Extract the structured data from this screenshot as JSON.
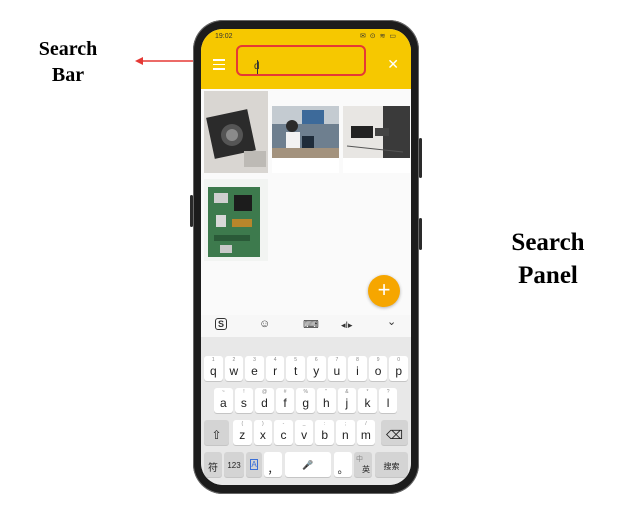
{
  "annotations": {
    "search_bar_line1": "Search",
    "search_bar_line2": "Bar",
    "search_panel_line1": "Search",
    "search_panel_line2": "Panel"
  },
  "status_bar": {
    "time": "19:02",
    "icons": "✉ ⊙ ≋ ▭"
  },
  "search": {
    "value": "d",
    "menu_icon": "menu-icon",
    "close_label": "✕"
  },
  "fab": {
    "label": "+"
  },
  "keyboard_toolbar": {
    "logo": "S",
    "emoji": "☺",
    "keyboard": "⌨",
    "cursor": "◂I▸",
    "collapse": "⌄"
  },
  "keyboard": {
    "row1": [
      {
        "hint": "1",
        "key": "q"
      },
      {
        "hint": "2",
        "key": "w"
      },
      {
        "hint": "3",
        "key": "e"
      },
      {
        "hint": "4",
        "key": "r"
      },
      {
        "hint": "5",
        "key": "t"
      },
      {
        "hint": "6",
        "key": "y"
      },
      {
        "hint": "7",
        "key": "u"
      },
      {
        "hint": "8",
        "key": "i"
      },
      {
        "hint": "9",
        "key": "o"
      },
      {
        "hint": "0",
        "key": "p"
      }
    ],
    "row2": [
      {
        "hint": "~",
        "key": "a"
      },
      {
        "hint": "!",
        "key": "s"
      },
      {
        "hint": "@",
        "key": "d"
      },
      {
        "hint": "#",
        "key": "f"
      },
      {
        "hint": "%",
        "key": "g"
      },
      {
        "hint": "\"",
        "key": "h"
      },
      {
        "hint": "&",
        "key": "j"
      },
      {
        "hint": "*",
        "key": "k"
      },
      {
        "hint": "?",
        "key": "l"
      }
    ],
    "row3": [
      {
        "hint": "(",
        "key": "z"
      },
      {
        "hint": ")",
        "key": "x"
      },
      {
        "hint": "-",
        "key": "c"
      },
      {
        "hint": "_",
        "key": "v"
      },
      {
        "hint": ":",
        "key": "b"
      },
      {
        "hint": ";",
        "key": "n"
      },
      {
        "hint": "/",
        "key": "m"
      }
    ],
    "shift": "⇧",
    "backspace": "⌫",
    "bottom": {
      "symbols": "符",
      "num": "123",
      "lang_badge": "A",
      "comma": "，",
      "space_icon": "🎤",
      "period": "。",
      "switch_top": "中",
      "switch_bottom": "英",
      "search": "搜索"
    }
  }
}
